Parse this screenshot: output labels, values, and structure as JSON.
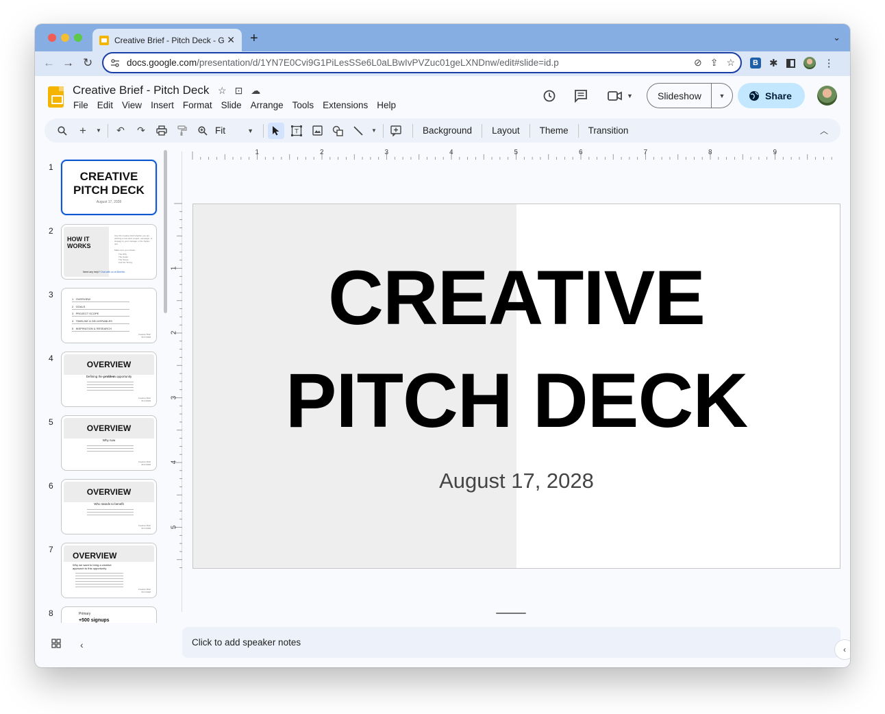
{
  "browser": {
    "tab_title": "Creative Brief - Pitch Deck - Go",
    "url_host": "docs.google.com",
    "url_path": "/presentation/d/1YN7E0Cvi9G1PiLesSSe6L0aLBwIvPVZuc01geLXNDnw/edit#slide=id.p"
  },
  "app": {
    "doc_title": "Creative Brief - Pitch Deck",
    "menu": [
      "File",
      "Edit",
      "View",
      "Insert",
      "Format",
      "Slide",
      "Arrange",
      "Tools",
      "Extensions",
      "Help"
    ],
    "slideshow_label": "Slideshow",
    "share_label": "Share",
    "accent_color": "#0b57d0",
    "brand_color": "#f4b400"
  },
  "toolbar": {
    "zoom_value": "Fit",
    "background_label": "Background",
    "layout_label": "Layout",
    "theme_label": "Theme",
    "transition_label": "Transition"
  },
  "ruler": {
    "h_ticks": [
      "1",
      "2",
      "3",
      "4",
      "5",
      "6",
      "7",
      "8",
      "9"
    ],
    "v_ticks": [
      "1",
      "2",
      "3",
      "4",
      "5"
    ]
  },
  "slide": {
    "title_line1": "CREATIVE",
    "title_line2": "PITCH DECK",
    "date": "August 17, 2028"
  },
  "thumbnails": {
    "numbers": [
      "1",
      "2",
      "3",
      "4",
      "5",
      "6",
      "7",
      "8"
    ],
    "t1": {
      "title_line1": "CREATIVE",
      "title_line2": "PITCH DECK",
      "date": "August 17, 2028"
    },
    "t2": {
      "title_line1": "HOW IT",
      "title_line2": "WORKS",
      "body": "Use this creative brief whether you are pitching a new idea: project, campaign, or strategy to your manager or the higher-ups.",
      "make_sure": "Make sure you include:",
      "bullets": [
        "The Why",
        "The Goals",
        "The Scope",
        "And the Timing"
      ],
      "help": "Need any help?",
      "help_link": "Chat with us at Beehiiv."
    },
    "t3": {
      "items": [
        "OVERVIEW",
        "GOALS",
        "PROJECT SCOPE",
        "TIMELINE & DELIVERABLES",
        "INSPIRATION & RESEARCH"
      ],
      "footer_line1": "Creative Brief",
      "footer_line2": "8/17/2028"
    },
    "t4": {
      "title": "OVERVIEW",
      "subtitle_pre": "Defining the ",
      "subtitle_bold": "problem",
      "subtitle_post": " opportunity"
    },
    "t5": {
      "title": "OVERVIEW",
      "subtitle": "Why now"
    },
    "t6": {
      "title": "OVERVIEW",
      "subtitle": "Who stands to benefit"
    },
    "t7": {
      "title": "OVERVIEW",
      "subtitle_line1": "Why we want to bring a creative",
      "subtitle_line2": "approach to this opportunity"
    },
    "t8": {
      "label": "Primary",
      "value": "+500 signups"
    }
  },
  "notes": {
    "placeholder": "Click to add speaker notes"
  }
}
